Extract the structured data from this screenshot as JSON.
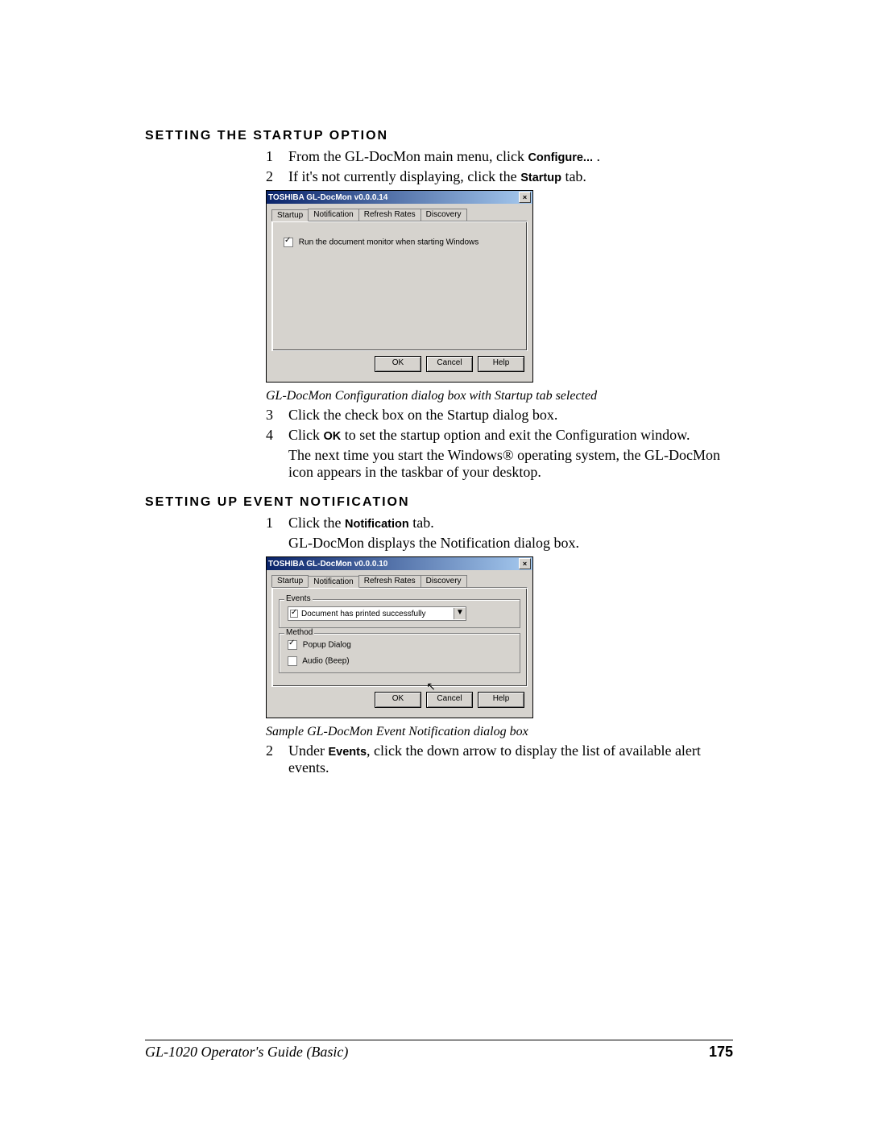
{
  "headings": {
    "h1": "SETTING THE STARTUP OPTION",
    "h2": "SETTING UP EVENT NOTIFICATION"
  },
  "s1": {
    "step1a": "From the GL-DocMon main menu, click ",
    "step1b": "Configure...",
    "step1c": " .",
    "step2a": "If it's not currently displaying, click the ",
    "step2b": "Startup",
    "step2c": " tab.",
    "caption": "GL-DocMon Configuration dialog box with Startup tab selected",
    "step3": "Click the check box on the Startup dialog box.",
    "step4a": "Click ",
    "step4b": "OK",
    "step4c": " to set the startup option and exit the Configuration window.",
    "para": "The next time you start the Windows® operating system, the GL-DocMon icon appears in the taskbar of your desktop."
  },
  "s2": {
    "step1a": "Click the ",
    "step1b": "Notification",
    "step1c": " tab.",
    "para1": "GL-DocMon displays the Notification dialog box.",
    "caption": "Sample GL-DocMon Event Notification dialog box",
    "step2a": "Under ",
    "step2b": "Events",
    "step2c": ", click the down arrow to display the list of available alert events."
  },
  "nums": {
    "n1": "1",
    "n2": "2",
    "n3": "3",
    "n4": "4"
  },
  "dialog1": {
    "title": "TOSHIBA GL-DocMon  v0.0.0.14",
    "tab1": "Startup",
    "tab2": "Notification",
    "tab3": "Refresh Rates",
    "tab4": "Discovery",
    "checklabel": "Run the document monitor when starting Windows",
    "ok": "OK",
    "cancel": "Cancel",
    "help": "Help"
  },
  "dialog2": {
    "title": "TOSHIBA GL-DocMon  v0.0.0.10",
    "tab1": "Startup",
    "tab2": "Notification",
    "tab3": "Refresh Rates",
    "tab4": "Discovery",
    "events_legend": "Events",
    "event_item": "Document has printed successfully",
    "method_legend": "Method",
    "popup": "Popup Dialog",
    "audio": "Audio (Beep)",
    "ok": "OK",
    "cancel": "Cancel",
    "help": "Help"
  },
  "footer": {
    "title": "GL-1020 Operator's Guide (Basic)",
    "page": "175"
  }
}
